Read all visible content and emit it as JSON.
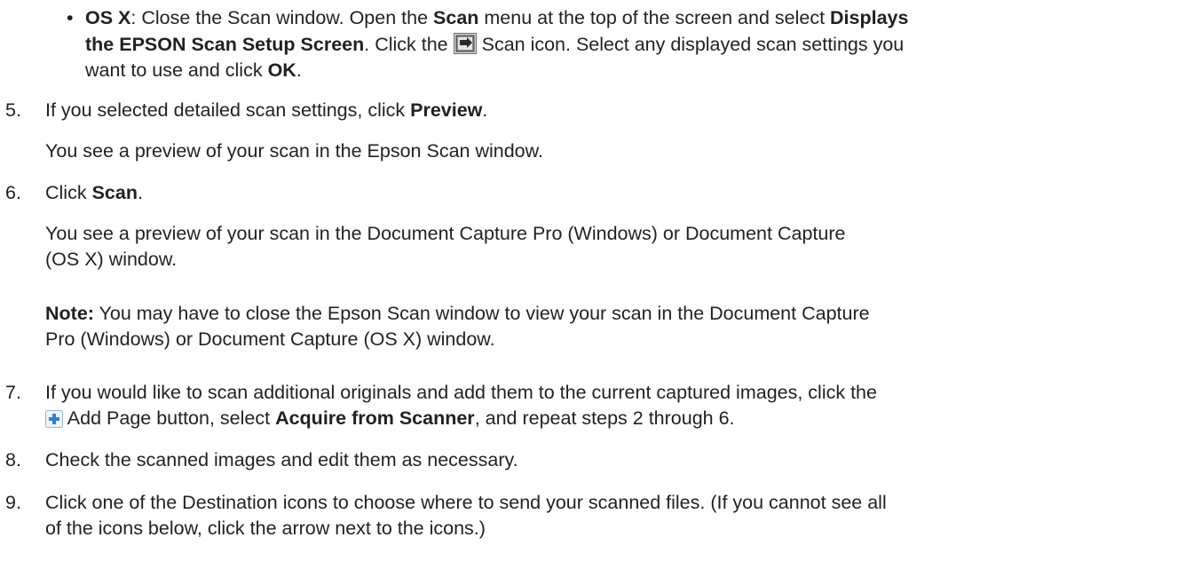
{
  "bullet_os_x": {
    "bullet": "•",
    "label": "OS X",
    "t1": ": Close the Scan window. Open the ",
    "scan_menu": "Scan",
    "t2": " menu at the top of the screen and select ",
    "displays": "Displays",
    "setup_screen": "the EPSON Scan Setup Screen",
    "t3": ". Click the ",
    "t4": " Scan icon. Select any displayed scan settings you",
    "t5": "want to use and click ",
    "ok": "OK",
    "t6": "."
  },
  "step5": {
    "number": "5.",
    "t1": "If you selected detailed scan settings, click ",
    "preview": "Preview",
    "t2": ".",
    "sub": "You see a preview of your scan in the Epson Scan window."
  },
  "step6": {
    "number": "6.",
    "t1": "Click ",
    "scan": "Scan",
    "t2": ".",
    "sub1": "You see a preview of your scan in the Document Capture Pro (Windows) or Document Capture",
    "sub2": "(OS X) window.",
    "note_label": "Note:",
    "note1": " You may have to close the Epson Scan window to view your scan in the Document Capture",
    "note2": "Pro (Windows) or Document Capture (OS X) window."
  },
  "step7": {
    "number": "7.",
    "line1": "If you would like to scan additional originals and add them to the current captured images, click the",
    "t1": " Add Page button, select ",
    "acquire": "Acquire from Scanner",
    "t2": ", and repeat steps 2 through 6."
  },
  "step8": {
    "number": "8.",
    "text": "Check the scanned images and edit them as necessary."
  },
  "step9": {
    "number": "9.",
    "line1": "Click one of the Destination icons to choose where to send your scanned files. (If you cannot see all",
    "line2": "of the icons below, click the arrow next to the icons.)"
  }
}
